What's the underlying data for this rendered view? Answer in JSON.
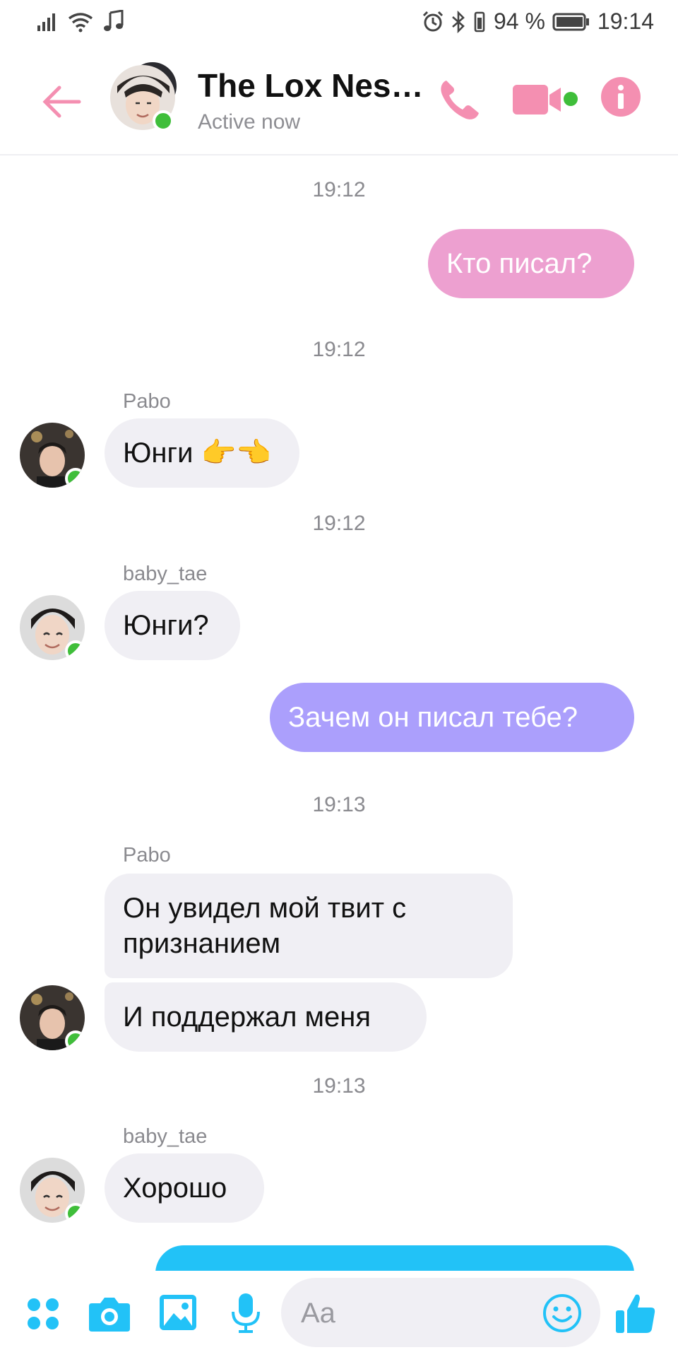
{
  "status_bar": {
    "battery_percent": "94 %",
    "time": "19:14",
    "icons": [
      "signal-icon",
      "wifi-icon",
      "music-note-icon",
      "alarm-icon",
      "bluetooth-icon",
      "vibrate-icon",
      "battery-icon"
    ]
  },
  "header": {
    "title": "The Lox Nes…",
    "subtitle": "Active now",
    "accent_color": "#f48fb1",
    "icons": [
      "back-arrow-icon",
      "phone-icon",
      "video-call-icon",
      "info-icon"
    ]
  },
  "messages": [
    {
      "time": "19:12"
    },
    {
      "direction": "out",
      "text": "Кто писал?",
      "color": "#eda0d0"
    },
    {
      "time": "19:12"
    },
    {
      "direction": "in",
      "sender": "Pabo",
      "text": "Юнги 👉👈"
    },
    {
      "time": "19:12"
    },
    {
      "direction": "in",
      "sender": "baby_tae",
      "text": "Юнги?"
    },
    {
      "direction": "out",
      "text": "Зачем он писал тебе?",
      "color": "#ab9ffc"
    },
    {
      "time": "19:13"
    },
    {
      "direction": "in",
      "sender": "Pabo",
      "text_lines": [
        "Он увидел мой твит с",
        "признанием"
      ]
    },
    {
      "direction": "in",
      "text": "И поддержал меня"
    },
    {
      "time": "19:13"
    },
    {
      "direction": "in",
      "sender": "baby_tae",
      "text": "Хорошо"
    },
    {
      "direction": "out",
      "text": "",
      "color": "#22c2f7"
    }
  ],
  "composer": {
    "placeholder": "Aa",
    "accent_color": "#22c2f7",
    "icons": [
      "apps-grid-icon",
      "camera-icon",
      "gallery-icon",
      "microphone-icon",
      "emoji-icon",
      "thumbs-up-icon"
    ]
  }
}
